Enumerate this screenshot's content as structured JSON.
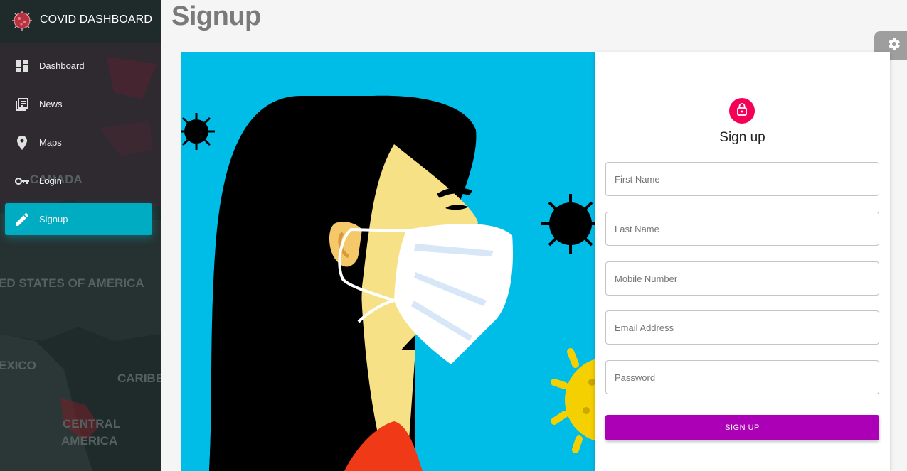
{
  "app": {
    "title": "COVID DASHBOARD",
    "logo_icon": "coronavirus-logo-icon"
  },
  "sidebar": {
    "background_color": "#1f2b2b",
    "active_color": "#00acc1",
    "map_labels": [
      "CANADA",
      "ED STATES OF AMERICA",
      "EXICO",
      "CARIBE",
      "CENTRAL",
      "AMERICA"
    ],
    "items": [
      {
        "label": "Dashboard",
        "icon": "dashboard-icon",
        "active": false
      },
      {
        "label": "News",
        "icon": "news-icon",
        "active": false
      },
      {
        "label": "Maps",
        "icon": "map-pin-icon",
        "active": false
      },
      {
        "label": "Login",
        "icon": "key-icon",
        "active": false
      },
      {
        "label": "Signup",
        "icon": "pencil-icon",
        "active": true
      }
    ]
  },
  "page": {
    "title": "Signup"
  },
  "settings": {
    "icon": "gear-icon"
  },
  "illustration": {
    "description_icon": "woman-with-mask-illustration",
    "background_color": "#00bde8"
  },
  "form": {
    "lock_icon": "lock-icon",
    "lock_color": "#f50057",
    "title": "Sign up",
    "fields": {
      "first_name": {
        "placeholder": "First Name",
        "value": ""
      },
      "last_name": {
        "placeholder": "Last Name",
        "value": ""
      },
      "mobile": {
        "placeholder": "Mobile Number",
        "value": ""
      },
      "email": {
        "placeholder": "Email Address",
        "value": ""
      },
      "password": {
        "placeholder": "Password",
        "value": ""
      }
    },
    "submit_label": "SIGN UP",
    "submit_color": "#ab00b5"
  }
}
